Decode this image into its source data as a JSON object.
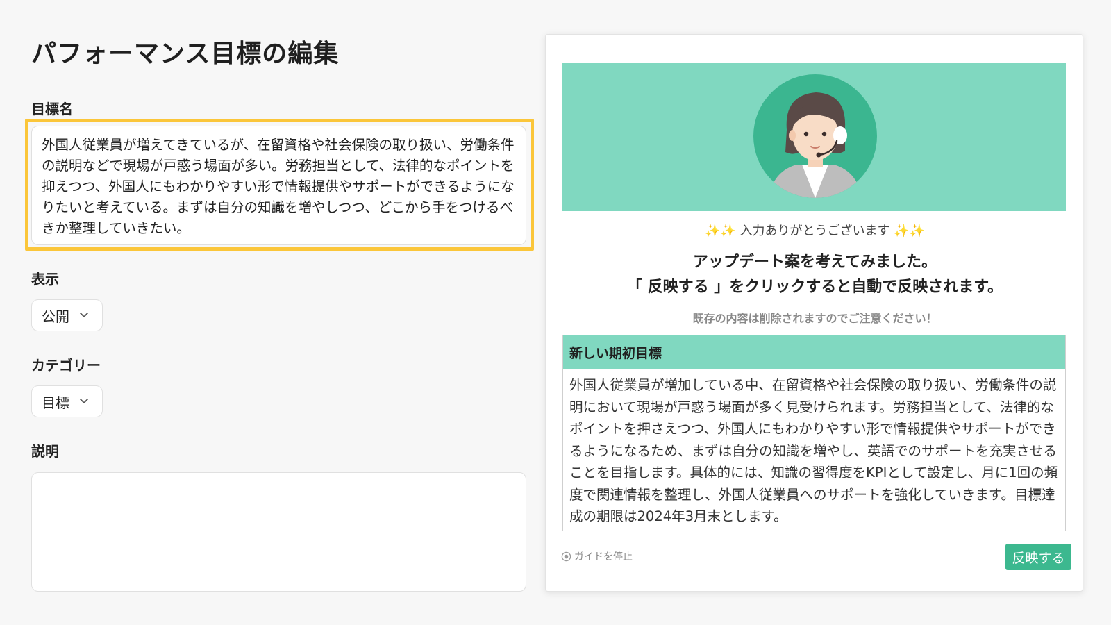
{
  "form": {
    "title": "パフォーマンス目標の編集",
    "goal_label": "目標名",
    "goal_value": "外国人従業員が増えてきているが、在留資格や社会保険の取り扱い、労働条件の説明などで現場が戸惑う場面が多い。労務担当として、法律的なポイントを抑えつつ、外国人にもわかりやすい形で情報提供やサポートができるようになりたいと考えている。まずは自分の知識を増やしつつ、どこから手をつけるべきか整理していきたい。",
    "visibility_label": "表示",
    "visibility_value": "公開",
    "category_label": "カテゴリー",
    "category_value": "目標",
    "description_label": "説明",
    "description_value": ""
  },
  "guide": {
    "thanks": "✨✨ 入力ありがとうございます ✨✨",
    "headline_1": "アップデート案を考えてみました。",
    "headline_2": "「 反映する 」をクリックすると自動で反映されます。",
    "warning": "既存の内容は削除されますのでご注意ください！",
    "proposal_title": "新しい期初目標",
    "proposal_body": "外国人従業員が増加している中、在留資格や社会保険の取り扱い、労働条件の説明において現場が戸惑う場面が多く見受けられます。労務担当として、法律的なポイントを押さえつつ、外国人にもわかりやすい形で情報提供やサポートができるようになるため、まずは自分の知識を増やし、英語でのサポートを充実させることを目指します。具体的には、知識の習得度をKPIとして設定し、月に1回の頻度で関連情報を整理し、外国人従業員へのサポートを強化していきます。目標達成の期限は2024年3月末とします。",
    "stop_label": "ガイドを停止",
    "apply_label": "反映する"
  },
  "colors": {
    "accent": "#3cb88f",
    "hero_bg": "#80d8c0",
    "highlight": "#fbc63a"
  },
  "icons": {
    "select_chevron": "chevron-down-icon",
    "avatar": "support-agent-icon",
    "stop": "stop-circle-icon"
  }
}
